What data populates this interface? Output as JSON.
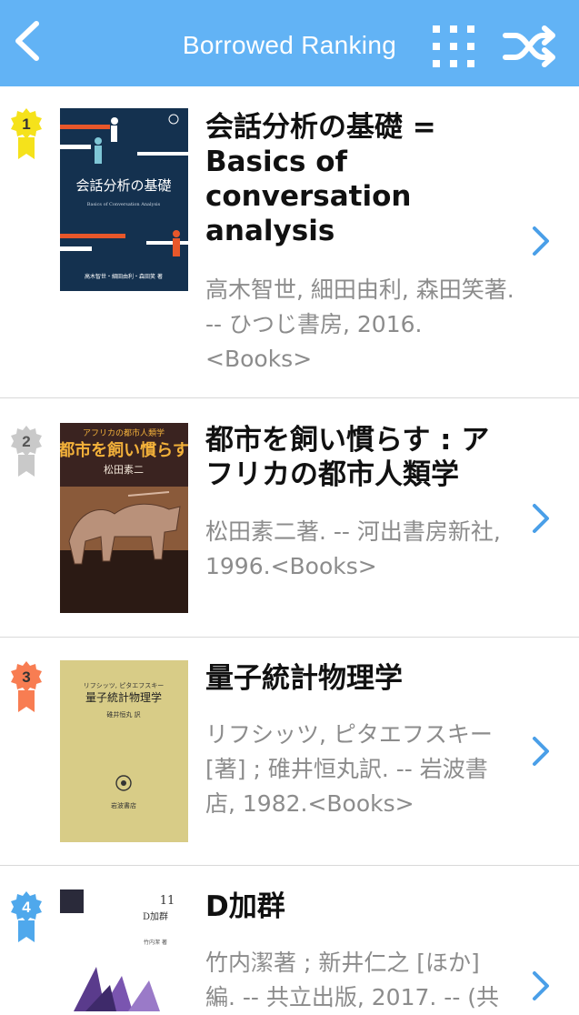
{
  "header": {
    "title": "Borrowed Ranking",
    "back_icon": "chevron-left-icon",
    "grid_icon": "grid-icon",
    "shuffle_icon": "shuffle-icon",
    "bg_color": "#62b3f5"
  },
  "books": [
    {
      "rank": "1",
      "badge_color": "#f5e21b",
      "title": "会話分析の基礎 = Basics of conversation analysis",
      "meta": "高木智世, 細田由利, 森田笑著. -- ひつじ書房, 2016.<Books>",
      "cover": {
        "title": "会話分析の基礎",
        "subtitle": "Basics of Conversation Analysis",
        "authors": "高木智世・細田由利・森田笑 著"
      }
    },
    {
      "rank": "2",
      "badge_color": "#c9c9c9",
      "title": "都市を飼い慣らす : アフリカの都市人類学",
      "meta": "松田素二著. -- 河出書房新社, 1996.<Books>",
      "cover": {
        "series": "アフリカの都市人類学",
        "title": "都市を飼い慣らす",
        "author": "松田素二"
      }
    },
    {
      "rank": "3",
      "badge_color": "#f87d52",
      "title": "量子統計物理学",
      "meta": "リフシッツ, ピタエフスキー [著] ; 碓井恒丸訳. -- 岩波書店, 1982.<Books>",
      "cover": {
        "authors": "リフシッツ, ピタエフスキー",
        "title": "量子統計物理学",
        "translator": "碓井恒丸 訳",
        "publisher": "岩波書店"
      }
    },
    {
      "rank": "4",
      "badge_color": "#4fa8ec",
      "title": "D加群",
      "meta": "竹内潔著 ; 新井仁之 [ほか] 編. -- 共立出版, 2017. -- (共",
      "cover": {
        "volume": "11",
        "title": "D加群",
        "author": "竹内潔 著"
      }
    }
  ]
}
